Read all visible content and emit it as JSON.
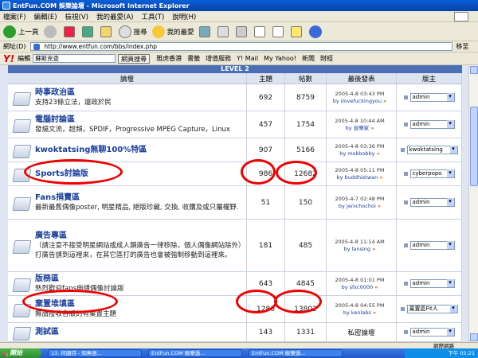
{
  "window": {
    "title": "EntFun.COM 娛樂論壇 - Microsoft Internet Explorer"
  },
  "menu": [
    "檔案(F)",
    "編輯(E)",
    "檢視(V)",
    "我的最愛(A)",
    "工具(T)",
    "說明(H)"
  ],
  "toolbar": {
    "back": "上一頁",
    "search": "搜尋",
    "favorites": "我的最愛"
  },
  "address": {
    "label": "網址(D)",
    "url": "http://www.entfun.com/bbs/index.php",
    "go": "移至"
  },
  "yahoo": {
    "logo": "Y!",
    "edit": "編輯",
    "query": "蘇斯克查",
    "search_btn": "網頁搜尋",
    "items": [
      "雅虎香港",
      "書籤",
      "增值服務",
      "Y! Mail",
      "My Yahoo!",
      "新聞",
      "財經"
    ]
  },
  "forum": {
    "level": "LEVEL 2",
    "headers": {
      "forum": "論壇",
      "topics": "主題",
      "posts": "帖數",
      "last": "最後發表",
      "mod": "版主"
    },
    "rows": [
      {
        "title": "時事政治區",
        "desc": "支持23條立法，還政於民",
        "topics": "692",
        "posts": "8759",
        "date": "2005-4-8 03:43 PM",
        "by": "by ilovefuckingyou",
        "mod": "admin"
      },
      {
        "title": "電腦討論區",
        "desc": "發燒文流，超頻，SPDIF，Progressive MPEG Capture，Linux",
        "topics": "457",
        "posts": "1754",
        "date": "2005-4-8 10:44 AM",
        "by": "by 音樂家",
        "mod": "admin"
      },
      {
        "title": "kwoktatsing無聊100%特區",
        "desc": "",
        "topics": "907",
        "posts": "5166",
        "date": "2005-4-8 03:36 PM",
        "by": "by mokbobby",
        "mod": "kwoktatsing"
      },
      {
        "title": "Sports討論版",
        "desc": "",
        "topics": "986",
        "posts": "12682",
        "date": "2005-4-8 05:11 PM",
        "by": "by buddhistwan",
        "mod": "cyberpopo"
      },
      {
        "title": "Fans捐賣區",
        "desc": "最新最舊偶像poster, 明星精品, 絕版珍藏, 交換, 收購及或只屬權野.",
        "topics": "51",
        "posts": "150",
        "date": "2005-4-7 02:48 PM",
        "by": "by jenichochoi",
        "mod": "admin"
      },
      {
        "title": "廣告專區",
        "desc": "（請注意不接受明星網站或成人類廣告一律移除，個人偶像網站除外）打廣告請到這裡來，在其它區打的廣告也會被強制移動到這裡來。",
        "topics": "181",
        "posts": "485",
        "date": "2005-4-8 11:14 AM",
        "by": "by lansing",
        "mod": "admin"
      },
      {
        "title": "版務區",
        "desc": "熱烈歡迎fans申請偶像討論版",
        "topics": "643",
        "posts": "4845",
        "date": "2005-4-8 01:01 PM",
        "by": "by sfxc0000",
        "mod": "admin"
      },
      {
        "title": "棄置堆填區",
        "desc": "無謂接收各版的有棄置主題",
        "topics": "1286",
        "posts": "13802",
        "date": "2005-4-8 04:55 PM",
        "by": "by kenlabs",
        "mod": "棄置區Fit人"
      },
      {
        "title": "測試區",
        "desc": "",
        "topics": "143",
        "posts": "1331",
        "date": "私密論壇",
        "by": "",
        "mod": "admin"
      }
    ]
  },
  "status": {
    "zone": "網際網路"
  },
  "taskbar": {
    "start": "開始",
    "items": [
      "13. 何韻詩 - 知無意...",
      "EntFun.COM 娛樂過...",
      "EntFun.COM 娛樂過..."
    ],
    "clock": "下午 05:21"
  }
}
